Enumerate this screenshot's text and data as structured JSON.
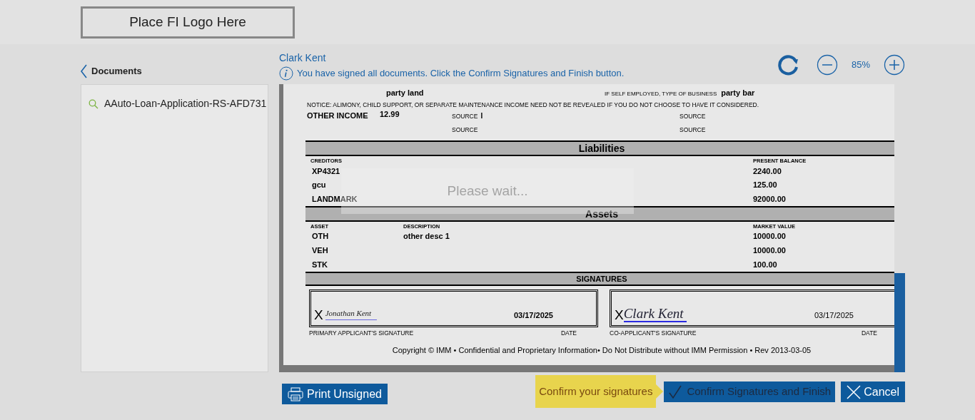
{
  "header": {
    "logo_placeholder": "Place FI Logo Here"
  },
  "sidebar": {
    "back_label": "Documents",
    "items": [
      {
        "name": "AAuto-Loan-Application-RS-AFD731"
      }
    ]
  },
  "viewer": {
    "signer": "Clark Kent",
    "message": "You have signed all documents. Click the Confirm Signatures and Finish button.",
    "zoom": "85%"
  },
  "document": {
    "employer_value": "party land",
    "business_label": "IF SELF EMPLOYED, TYPE OF BUSINESS",
    "business_value": "party bar",
    "notice": "NOTICE: ALIMONY, CHILD SUPPORT, OR SEPARATE MAINTENANCE INCOME NEED NOT BE REVEALED IF YOU DO NOT CHOOSE TO HAVE IT CONSIDERED.",
    "other_income_label": "OTHER INCOME",
    "other_income_value": "12.99",
    "sources": [
      {
        "label": "SOURCE",
        "value": "I"
      },
      {
        "label": "SOURCE"
      },
      {
        "label": "SOURCE"
      },
      {
        "label": "SOURCE"
      }
    ],
    "liabilities": {
      "title": "Liabilities",
      "columns": [
        "CREDITORS",
        "PRESENT BALANCE"
      ],
      "rows": [
        {
          "creditor": "XP4321",
          "balance": "2240.00"
        },
        {
          "creditor": "gcu",
          "balance": "125.00"
        },
        {
          "creditor": "LANDMARK",
          "balance": "92000.00"
        }
      ]
    },
    "assets": {
      "title": "Assets",
      "columns": [
        "ASSET",
        "DESCRIPTION",
        "MARKET VALUE"
      ],
      "rows": [
        {
          "asset": "OTH",
          "description": "other desc 1",
          "value": "10000.00"
        },
        {
          "asset": "VEH",
          "value": "10000.00"
        },
        {
          "asset": "STK",
          "value": "100.00"
        }
      ]
    },
    "signatures": {
      "title": "SIGNATURES",
      "boxes": [
        {
          "mark": "X",
          "signature": "Jonathan Kent",
          "date": "03/17/2025",
          "label": "PRIMARY APPLICANT'S SIGNATURE",
          "date_label": "DATE"
        },
        {
          "mark": "X",
          "signature": "Clark Kent",
          "date": "03/17/2025",
          "label": "CO-APPLICANT'S SIGNATURE",
          "date_label": "DATE"
        }
      ]
    },
    "copyright": "Copyright © IMM • Confidential and Proprietary Information• Do Not Distribute without IMM Permission • Rev 2013-03-05"
  },
  "overlay": {
    "text": "Please wait..."
  },
  "footer": {
    "print": "Print Unsigned",
    "tooltip": "Confirm your signatures",
    "confirm": "Confirm Signatures and Finish",
    "cancel": "Cancel"
  }
}
